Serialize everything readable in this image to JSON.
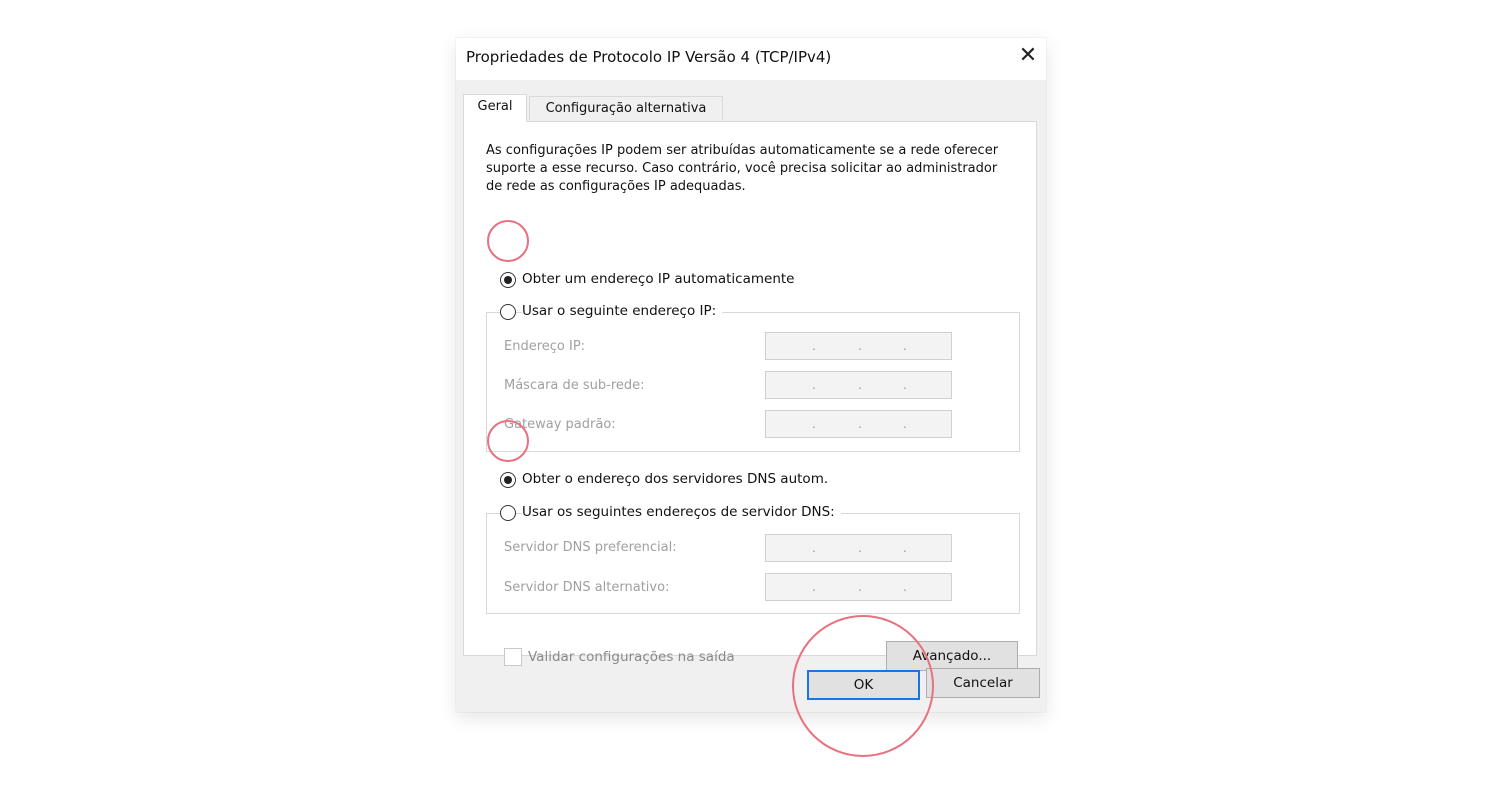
{
  "dialog": {
    "title": "Propriedades de Protocolo IP Versão 4 (TCP/IPv4)",
    "close_glyph": "✕"
  },
  "tabs": [
    {
      "label": "Geral",
      "active": true
    },
    {
      "label": "Configuração alternativa",
      "active": false
    }
  ],
  "description": "As configurações IP podem ser atribuídas automaticamente se a rede oferecer suporte a esse recurso. Caso contrário, você precisa solicitar ao administrador de rede as configurações IP adequadas.",
  "ip": {
    "auto_label": "Obter um endereço IP automaticamente",
    "auto_selected": true,
    "manual_label": "Usar o seguinte endereço IP:",
    "fields": [
      {
        "label": "Endereço IP:",
        "value": ". . ."
      },
      {
        "label": "Máscara de sub-rede:",
        "value": ". . ."
      },
      {
        "label": "Gateway padrão:",
        "value": ". . ."
      }
    ]
  },
  "dns": {
    "auto_label": "Obter o endereço dos servidores DNS autom.",
    "auto_selected": true,
    "manual_label": "Usar os seguintes endereços de servidor DNS:",
    "fields": [
      {
        "label": "Servidor DNS preferencial:",
        "value": ". . ."
      },
      {
        "label": "Servidor DNS alternativo:",
        "value": ". . ."
      }
    ]
  },
  "validate": {
    "label": "Validar configurações na saída",
    "checked": false
  },
  "buttons": {
    "advanced": "Avançado...",
    "ok": "OK",
    "cancel": "Cancelar"
  },
  "colors": {
    "highlight": "#e8717f",
    "focus": "#1a73e8"
  }
}
